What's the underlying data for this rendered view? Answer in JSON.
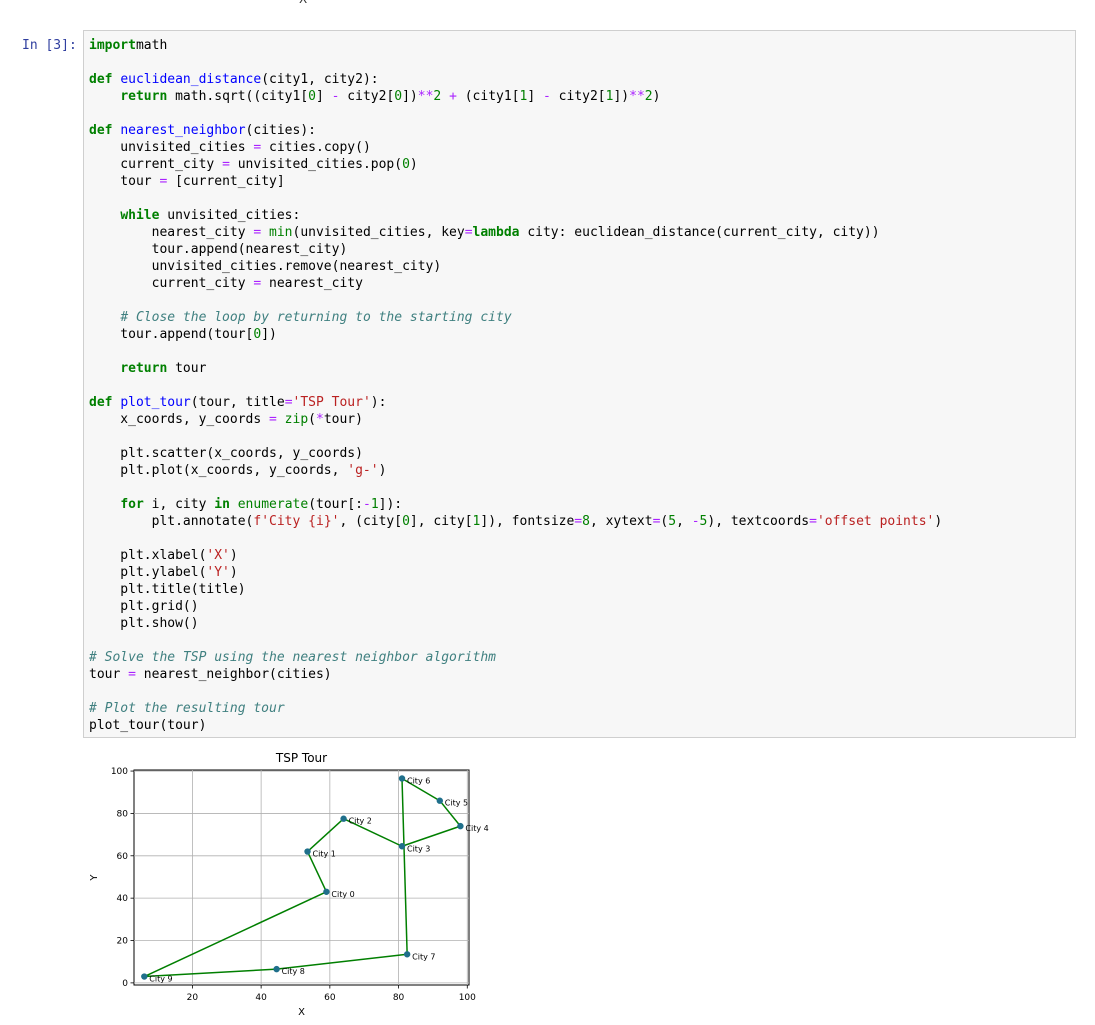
{
  "prompt": "In [3]:",
  "top_fragment": "X",
  "code_lines": [
    [
      [
        "kw",
        "import"
      ],
      [
        "",
        "math"
      ]
    ],
    [],
    [
      [
        "kw",
        "def"
      ],
      [
        "",
        " "
      ],
      [
        "fn",
        "euclidean_distance"
      ],
      [
        "",
        "(city1, city2):"
      ]
    ],
    [
      [
        "",
        "    "
      ],
      [
        "kw",
        "return"
      ],
      [
        "",
        " math.sqrt((city1["
      ],
      [
        "num",
        "0"
      ],
      [
        "",
        "] "
      ],
      [
        "op",
        "-"
      ],
      [
        "",
        " city2["
      ],
      [
        "num",
        "0"
      ],
      [
        "",
        "])"
      ],
      [
        "op",
        "**"
      ],
      [
        "num",
        "2"
      ],
      [
        "",
        " "
      ],
      [
        "op",
        "+"
      ],
      [
        "",
        " (city1["
      ],
      [
        "num",
        "1"
      ],
      [
        "",
        "] "
      ],
      [
        "op",
        "-"
      ],
      [
        "",
        " city2["
      ],
      [
        "num",
        "1"
      ],
      [
        "",
        "])"
      ],
      [
        "op",
        "**"
      ],
      [
        "num",
        "2"
      ],
      [
        "",
        ")"
      ]
    ],
    [],
    [
      [
        "kw",
        "def"
      ],
      [
        "",
        " "
      ],
      [
        "fn",
        "nearest_neighbor"
      ],
      [
        "",
        "(cities):"
      ]
    ],
    [
      [
        "",
        "    unvisited_cities "
      ],
      [
        "op",
        "="
      ],
      [
        "",
        " cities.copy()"
      ]
    ],
    [
      [
        "",
        "    current_city "
      ],
      [
        "op",
        "="
      ],
      [
        "",
        " unvisited_cities.pop("
      ],
      [
        "num",
        "0"
      ],
      [
        "",
        ")"
      ]
    ],
    [
      [
        "",
        "    tour "
      ],
      [
        "op",
        "="
      ],
      [
        "",
        " [current_city]"
      ]
    ],
    [],
    [
      [
        "",
        "    "
      ],
      [
        "kw",
        "while"
      ],
      [
        "",
        " unvisited_cities:"
      ]
    ],
    [
      [
        "",
        "        nearest_city "
      ],
      [
        "op",
        "="
      ],
      [
        "",
        " "
      ],
      [
        "bi",
        "min"
      ],
      [
        "",
        "(unvisited_cities, key"
      ],
      [
        "op",
        "="
      ],
      [
        "kw",
        "lambda"
      ],
      [
        "",
        " city: euclidean_distance(current_city, city))"
      ]
    ],
    [
      [
        "",
        "        tour.append(nearest_city)"
      ]
    ],
    [
      [
        "",
        "        unvisited_cities.remove(nearest_city)"
      ]
    ],
    [
      [
        "",
        "        current_city "
      ],
      [
        "op",
        "="
      ],
      [
        "",
        " nearest_city"
      ]
    ],
    [],
    [
      [
        "",
        "    "
      ],
      [
        "cm",
        "# Close the loop by returning to the starting city"
      ]
    ],
    [
      [
        "",
        "    tour.append(tour["
      ],
      [
        "num",
        "0"
      ],
      [
        "",
        "])"
      ]
    ],
    [],
    [
      [
        "",
        "    "
      ],
      [
        "kw",
        "return"
      ],
      [
        "",
        " tour"
      ]
    ],
    [],
    [
      [
        "kw",
        "def"
      ],
      [
        "",
        " "
      ],
      [
        "fn",
        "plot_tour"
      ],
      [
        "",
        "(tour, title"
      ],
      [
        "op",
        "="
      ],
      [
        "str",
        "'TSP Tour'"
      ],
      [
        "",
        "):"
      ]
    ],
    [
      [
        "",
        "    x_coords, y_coords "
      ],
      [
        "op",
        "="
      ],
      [
        "",
        " "
      ],
      [
        "bi",
        "zip"
      ],
      [
        "",
        "("
      ],
      [
        "op",
        "*"
      ],
      [
        "",
        "tour)"
      ]
    ],
    [],
    [
      [
        "",
        "    plt.scatter(x_coords, y_coords)"
      ]
    ],
    [
      [
        "",
        "    plt.plot(x_coords, y_coords, "
      ],
      [
        "str",
        "'g-'"
      ],
      [
        "",
        ")"
      ]
    ],
    [],
    [
      [
        "",
        "    "
      ],
      [
        "kw",
        "for"
      ],
      [
        "",
        " i, city "
      ],
      [
        "kw",
        "in"
      ],
      [
        "",
        " "
      ],
      [
        "bi",
        "enumerate"
      ],
      [
        "",
        "(tour[:"
      ],
      [
        "op",
        "-"
      ],
      [
        "num",
        "1"
      ],
      [
        "",
        "]):"
      ]
    ],
    [
      [
        "",
        "        plt.annotate("
      ],
      [
        "str",
        "f'City {i}'"
      ],
      [
        "",
        ", (city["
      ],
      [
        "num",
        "0"
      ],
      [
        "",
        "], city["
      ],
      [
        "num",
        "1"
      ],
      [
        "",
        "]), fontsize"
      ],
      [
        "op",
        "="
      ],
      [
        "num",
        "8"
      ],
      [
        "",
        ", xytext"
      ],
      [
        "op",
        "="
      ],
      [
        "",
        "("
      ],
      [
        "num",
        "5"
      ],
      [
        "",
        ", "
      ],
      [
        "op",
        "-"
      ],
      [
        "num",
        "5"
      ],
      [
        "",
        "), textcoords"
      ],
      [
        "op",
        "="
      ],
      [
        "str",
        "'offset points'"
      ],
      [
        "",
        ")"
      ]
    ],
    [],
    [
      [
        "",
        "    plt.xlabel("
      ],
      [
        "str",
        "'X'"
      ],
      [
        "",
        ")"
      ]
    ],
    [
      [
        "",
        "    plt.ylabel("
      ],
      [
        "str",
        "'Y'"
      ],
      [
        "",
        ")"
      ]
    ],
    [
      [
        "",
        "    plt.title(title)"
      ]
    ],
    [
      [
        "",
        "    plt.grid()"
      ]
    ],
    [
      [
        "",
        "    plt.show()"
      ]
    ],
    [],
    [
      [
        "cm",
        "# Solve the TSP using the nearest neighbor algorithm"
      ]
    ],
    [
      [
        "",
        "tour "
      ],
      [
        "op",
        "="
      ],
      [
        "",
        " nearest_neighbor(cities)"
      ]
    ],
    [],
    [
      [
        "cm",
        "# Plot the resulting tour"
      ]
    ],
    [
      [
        "",
        "plot_tour(tour)"
      ]
    ]
  ],
  "chart_data": {
    "type": "line",
    "title": "TSP Tour",
    "xlabel": "X",
    "ylabel": "Y",
    "xlim": [
      3,
      100.5
    ],
    "ylim": [
      -1,
      100.5
    ],
    "xticks": [
      20,
      40,
      60,
      80,
      100
    ],
    "yticks": [
      0,
      20,
      40,
      60,
      80,
      100
    ],
    "grid": true,
    "line_color": "#007f00",
    "marker_color": "#1f6f8b",
    "points": [
      {
        "label": "City 0",
        "x": 59,
        "y": 43
      },
      {
        "label": "City 1",
        "x": 53.5,
        "y": 62
      },
      {
        "label": "City 2",
        "x": 64,
        "y": 77.5
      },
      {
        "label": "City 3",
        "x": 81,
        "y": 64.5
      },
      {
        "label": "City 4",
        "x": 98,
        "y": 74
      },
      {
        "label": "City 5",
        "x": 92,
        "y": 86
      },
      {
        "label": "City 6",
        "x": 81,
        "y": 96.5
      },
      {
        "label": "City 7",
        "x": 82.5,
        "y": 13.5
      },
      {
        "label": "City 8",
        "x": 44.5,
        "y": 6.5
      },
      {
        "label": "City 9",
        "x": 6,
        "y": 3
      }
    ],
    "closed": true
  }
}
